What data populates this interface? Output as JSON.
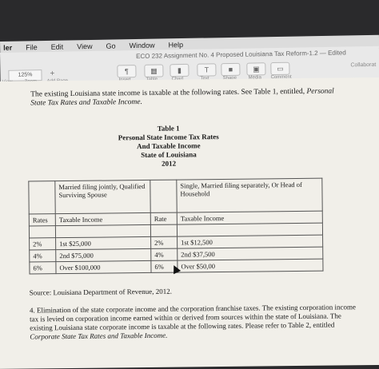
{
  "menubar": {
    "items": [
      "ler",
      "File",
      "Edit",
      "View",
      "Go",
      "Window",
      "Help"
    ]
  },
  "toolbar": {
    "window_title": "ECO 232 Assignment No. 4 Proposed Louisiana Tax Reform-1.2 — Edited",
    "zoom_value": "125%",
    "labels": {
      "view": "View",
      "zoom": "Zoom",
      "add_page": "Add Page",
      "insert": "Insert",
      "table": "Table",
      "chart": "Chart",
      "text": "Text",
      "shape": "Shape",
      "media": "Media",
      "comment": "Comment",
      "collaborate": "Collaborat"
    }
  },
  "document": {
    "intro_text": "The existing Louisiana state income is taxable at the following rates. See Table 1, entitled,",
    "intro_italic": "Personal State Tax Rates and Taxable Income.",
    "caption": [
      "Table 1",
      "Personal State Income Tax Rates",
      "And Taxable Income",
      "State of Louisiana",
      "2012"
    ],
    "table": {
      "group_left": "Married filing jointly, Qualified Surviving Spouse",
      "group_right": "Single, Married filing separately, Or Head of Household",
      "col_rates": "Rates",
      "col_income": "Taxable Income",
      "col_rate": "Rate",
      "rows": [
        {
          "rate_left": "2%",
          "income_left": "1st $25,000",
          "rate_right": "2%",
          "income_right": "1st $12,500"
        },
        {
          "rate_left": "4%",
          "income_left": "2nd $75,000",
          "rate_right": "4%",
          "income_right": "2nd $37,500"
        },
        {
          "rate_left": "6%",
          "income_left": "Over $100,000",
          "rate_right": "6%",
          "income_right": "Over $50,00"
        }
      ]
    },
    "source": "Source: Louisiana Department of Revenue, 2012.",
    "para4_text": "4. Elimination of the state corporate income and the corporation franchise taxes. The existing corporation income tax is levied on corporation income earned within or derived from sources within the state of Louisiana. The existing Louisiana state corporate income is taxable at the following rates. Please refer to Table 2, entitled",
    "para4_italic": "Corporate State Tax Rates and Taxable Income."
  }
}
